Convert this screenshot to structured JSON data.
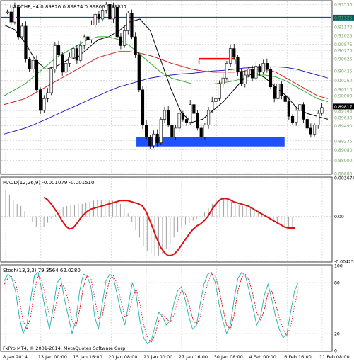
{
  "chart_data": [
    {
      "type": "candlestick",
      "panel": "price",
      "title": "USDCHF,H4 0.89826 0.89874 0.89806 0.89817",
      "y_ticks": [
        "0.91550",
        "0.91325",
        "0.91170",
        "0.91025",
        "0.90875",
        "0.90770",
        "0.90625",
        "0.90425",
        "0.90260",
        "0.90110",
        "0.90000",
        "0.89745",
        "0.89630",
        "0.89490",
        "0.89235",
        "0.89080",
        "0.88900",
        "0.88680"
      ],
      "ylim": [
        0.8868,
        0.916
      ],
      "current_price_label": "0.89817",
      "horizontal_levels": [
        {
          "price": 0.91325,
          "color": "#006060"
        },
        {
          "price": 0.90625,
          "color": "#ff0000",
          "x_range": [
            0.6,
            0.71
          ]
        },
        {
          "price": 0.893,
          "color": "#2050ff",
          "x_range": [
            0.41,
            0.86
          ],
          "zone_to": 0.8914
        }
      ],
      "close_path": [
        0.9142,
        0.9125,
        0.915,
        0.91,
        0.9118,
        0.9062,
        0.9045,
        0.906,
        0.901,
        0.8975,
        0.8995,
        0.9005,
        0.9045,
        0.9085,
        0.907,
        0.904,
        0.9055,
        0.9065,
        0.908,
        0.906,
        0.9085,
        0.91,
        0.9095,
        0.912,
        0.9138,
        0.913,
        0.9145,
        0.9155,
        0.913,
        0.915,
        0.91,
        0.9085,
        0.911,
        0.914,
        0.91,
        0.907,
        0.901,
        0.895,
        0.893,
        0.8915,
        0.8935,
        0.892,
        0.896,
        0.8975,
        0.895,
        0.893,
        0.8945,
        0.897,
        0.896,
        0.8955,
        0.8985,
        0.897,
        0.8945,
        0.893,
        0.895,
        0.8975,
        0.899,
        0.8995,
        0.902,
        0.903,
        0.9055,
        0.908,
        0.9065,
        0.904,
        0.902,
        0.9035,
        0.9045,
        0.903,
        0.905,
        0.904,
        0.9055,
        0.9045,
        0.9015,
        0.8995,
        0.902,
        0.9,
        0.899,
        0.8965,
        0.8955,
        0.8975,
        0.8985,
        0.896,
        0.8945,
        0.8935,
        0.895,
        0.897,
        0.898
      ],
      "moving_averages": [
        {
          "color": "#000000",
          "values": [
            0.912,
            0.9112,
            0.909,
            0.906,
            0.9045,
            0.905,
            0.906,
            0.9065,
            0.908,
            0.9095,
            0.91,
            0.911,
            0.9125,
            0.913,
            0.911,
            0.906,
            0.901,
            0.897,
            0.8955,
            0.896,
            0.8975,
            0.899,
            0.901,
            0.903,
            0.904,
            0.903,
            0.9015,
            0.9,
            0.898,
            0.897,
            0.8965,
            0.896
          ]
        },
        {
          "color": "#30b030",
          "values": [
            0.9,
            0.901,
            0.902,
            0.9035,
            0.905,
            0.9065,
            0.9075,
            0.9085,
            0.9095,
            0.91,
            0.91,
            0.9095,
            0.9085,
            0.907,
            0.9055,
            0.904,
            0.903,
            0.9025,
            0.902,
            0.902,
            0.902,
            0.9022,
            0.9025,
            0.903,
            0.9035,
            0.9035,
            0.9032,
            0.9025,
            0.9015,
            0.9005,
            0.8995,
            0.899
          ]
        },
        {
          "color": "#d02020",
          "values": [
            0.8985,
            0.899,
            0.8995,
            0.9005,
            0.9015,
            0.9025,
            0.9035,
            0.9045,
            0.9055,
            0.9065,
            0.907,
            0.9075,
            0.9075,
            0.9072,
            0.9068,
            0.9062,
            0.9055,
            0.905,
            0.9045,
            0.9042,
            0.904,
            0.904,
            0.904,
            0.9042,
            0.9045,
            0.9045,
            0.904,
            0.903,
            0.902,
            0.901,
            0.9,
            0.8995
          ]
        },
        {
          "color": "#2020c0",
          "values": [
            0.8935,
            0.894,
            0.8945,
            0.8952,
            0.896,
            0.8968,
            0.8976,
            0.8984,
            0.8992,
            0.9,
            0.9008,
            0.9015,
            0.902,
            0.9025,
            0.903,
            0.9033,
            0.9035,
            0.9037,
            0.9038,
            0.904,
            0.9042,
            0.9043,
            0.9045,
            0.9047,
            0.9048,
            0.9049,
            0.9049,
            0.9048,
            0.9045,
            0.904,
            0.9035,
            0.903
          ]
        }
      ]
    },
    {
      "type": "histogram+line",
      "panel": "macd",
      "title": "MACD(12,26,9) -0.001079 -0.001510",
      "y_ticks": [
        "0.003674",
        "0.00",
        "-0.004259"
      ],
      "ylim": [
        -0.004259,
        0.003674
      ],
      "histogram": [
        0.0025,
        0.002,
        0.0015,
        0.0012,
        0.001,
        0.0005,
        0.0,
        -0.0005,
        -0.001,
        -0.0012,
        -0.001,
        -0.0006,
        -0.0002,
        0.0002,
        0.0006,
        0.0009,
        0.001,
        0.0011,
        0.0011,
        0.0012,
        0.0012,
        0.0013,
        0.0014,
        0.0015,
        0.0016,
        0.0016,
        0.0016,
        0.0015,
        0.0015,
        0.0014,
        0.0012,
        0.0008,
        0.0003,
        -0.0005,
        -0.0013,
        -0.002,
        -0.0028,
        -0.0033,
        -0.0036,
        -0.0038,
        -0.0037,
        -0.0035,
        -0.0031,
        -0.0026,
        -0.002,
        -0.0015,
        -0.0011,
        -0.0008,
        -0.0006,
        -0.0004,
        -0.0002,
        0.0,
        0.0004,
        0.0008,
        0.0012,
        0.0015,
        0.0017,
        0.0017,
        0.0016,
        0.0014,
        0.0012,
        0.0011,
        0.001,
        0.001,
        0.0009,
        0.0007,
        0.0005,
        0.0003,
        0.0001,
        -0.0001,
        -0.0003,
        -0.0005,
        -0.0007,
        -0.0009,
        -0.0011,
        -0.0011
      ],
      "signal": [
        0.0018,
        0.0016,
        0.0012,
        0.0007,
        0.0002,
        -0.0004,
        -0.0009,
        -0.0012,
        -0.0011,
        -0.0007,
        -0.0002,
        0.0002,
        0.0005,
        0.0007,
        0.0008,
        0.0009,
        0.001,
        0.0011,
        0.0012,
        0.0013,
        0.0014,
        0.0015,
        0.0015,
        0.0015,
        0.0014,
        0.0013,
        0.0012,
        0.001,
        0.0005,
        -0.0003,
        -0.0012,
        -0.0021,
        -0.0029,
        -0.0034,
        -0.0037,
        -0.0037,
        -0.0035,
        -0.0031,
        -0.0026,
        -0.0021,
        -0.0016,
        -0.0012,
        -0.0009,
        -0.0007,
        -0.0004,
        0.0,
        0.0006,
        0.0011,
        0.0015,
        0.0017,
        0.0017,
        0.0016,
        0.0014,
        0.0013,
        0.0012,
        0.0011,
        0.001,
        0.0008,
        0.0006,
        0.0004,
        0.0002,
        0.0,
        -0.0002,
        -0.0004,
        -0.0006,
        -0.0008,
        -0.001,
        -0.0011,
        -0.0011,
        -0.0011
      ],
      "signal_color": "#e01010"
    },
    {
      "type": "line",
      "panel": "stochastic",
      "title": "Stoch(13,3,3) 79.3564 62.0280",
      "y_ticks": [
        "100",
        "80",
        "20",
        "0"
      ],
      "ylim": [
        0,
        100
      ],
      "series": [
        {
          "color": "#20b0b0",
          "values": [
            82,
            90,
            85,
            70,
            40,
            20,
            30,
            60,
            88,
            92,
            70,
            45,
            25,
            50,
            80,
            85,
            60,
            40,
            20,
            35,
            70,
            90,
            88,
            75,
            40,
            25,
            55,
            82,
            90,
            85,
            65,
            45,
            30,
            55,
            80,
            65,
            35,
            15,
            8,
            12,
            28,
            45,
            40,
            30,
            35,
            55,
            70,
            75,
            60,
            40,
            25,
            30,
            55,
            78,
            90,
            92,
            80,
            55,
            35,
            20,
            30,
            60,
            85,
            92,
            88,
            70,
            50,
            30,
            40,
            65,
            78,
            60,
            40,
            25,
            15,
            20,
            45,
            70,
            80
          ]
        },
        {
          "color": "#e01010",
          "dash": true,
          "values": [
            78,
            85,
            87,
            80,
            60,
            35,
            25,
            40,
            70,
            88,
            82,
            62,
            40,
            38,
            60,
            78,
            75,
            58,
            35,
            28,
            48,
            75,
            88,
            85,
            62,
            38,
            40,
            65,
            84,
            88,
            78,
            58,
            40,
            42,
            62,
            72,
            55,
            30,
            15,
            10,
            18,
            35,
            42,
            38,
            33,
            42,
            58,
            70,
            68,
            55,
            38,
            30,
            40,
            62,
            80,
            90,
            88,
            72,
            50,
            30,
            25,
            42,
            70,
            86,
            90,
            82,
            65,
            45,
            35,
            48,
            68,
            70,
            55,
            38,
            25,
            18,
            28,
            52,
            72
          ]
        }
      ]
    }
  ],
  "x_axis": {
    "tick_labels": [
      "8 Jan 2014",
      "13 Jan 00:00",
      "15 Jan 16:00",
      "20 Jan 08:00",
      "23 Jan 00:00",
      "27 Jan 16:00",
      "30 Jan 08:00",
      "4 Feb 00:00",
      "6 Feb 16:00",
      "11 Feb 08:00"
    ]
  },
  "footer": {
    "copyright": "FxPro MT4, © 2001-2014, MetaQuotes Software Corp."
  },
  "colors": {
    "background": "#ffffff",
    "grid": "#c8c8c8",
    "axis_label_green": "#7aa26a",
    "candle_bull": "#ffffff",
    "candle_bear": "#000000"
  }
}
